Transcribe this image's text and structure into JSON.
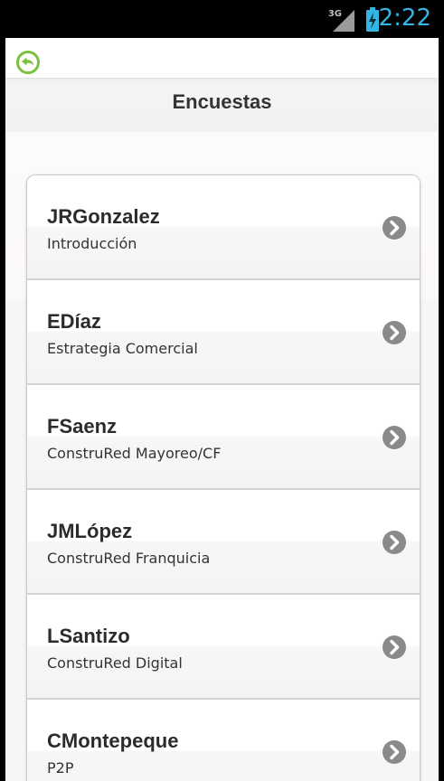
{
  "status_bar": {
    "network": "3G",
    "time": "2:22",
    "icons": [
      "signal-icon",
      "battery-charging-icon"
    ],
    "colors": {
      "accent": "#33b5e5"
    }
  },
  "header": {
    "back_icon": "back-arrow-icon",
    "title": "Encuestas"
  },
  "list": {
    "items": [
      {
        "name": "JRGonzalez",
        "subtitle": "Introducción"
      },
      {
        "name": "EDíaz",
        "subtitle": "Estrategia Comercial"
      },
      {
        "name": "FSaenz",
        "subtitle": "ConstruRed Mayoreo/CF"
      },
      {
        "name": "JMLópez",
        "subtitle": "ConstruRed Franquicia"
      },
      {
        "name": "LSantizo",
        "subtitle": "ConstruRed Digital"
      },
      {
        "name": "CMontepeque",
        "subtitle": "P2P"
      }
    ],
    "item_icon": "chevron-right-circle-icon"
  },
  "colors": {
    "back_icon": "#7cc13d",
    "chevron": "#8a8a8a"
  }
}
